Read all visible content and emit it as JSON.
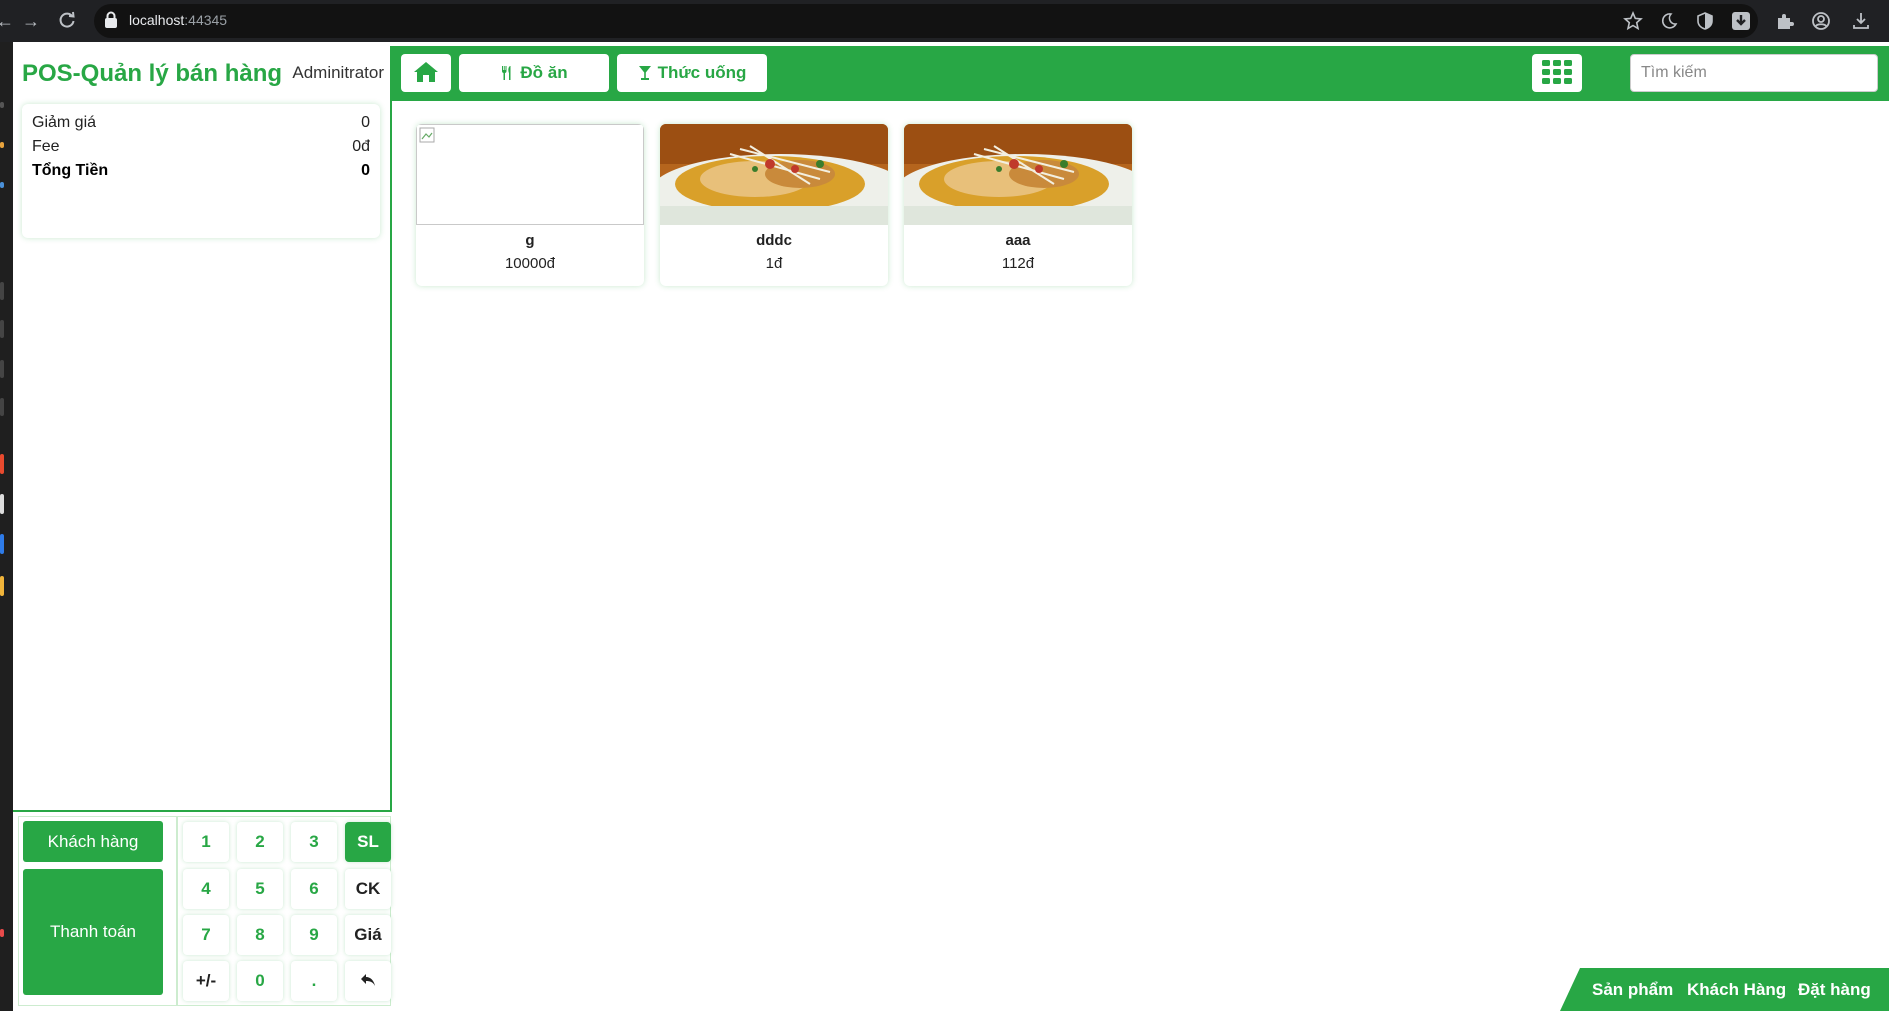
{
  "browser": {
    "url_host": "localhost",
    "url_port": ":44345"
  },
  "app": {
    "title": "POS-Quản lý bán hàng",
    "user": "Adminitrator"
  },
  "summary": {
    "discount_label": "Giảm giá",
    "discount_value": "0",
    "fee_label": "Fee",
    "fee_value": "0đ",
    "total_label": "Tổng Tiền",
    "total_value": "0"
  },
  "keypad": {
    "customer_label": "Khách hàng",
    "pay_label": "Thanh toán",
    "keys": [
      "1",
      "2",
      "3",
      "SL",
      "4",
      "5",
      "6",
      "CK",
      "7",
      "8",
      "9",
      "Giá",
      "+/-",
      "0",
      ".",
      "↶"
    ]
  },
  "toolbar": {
    "food_label": "Đồ ăn",
    "drinks_label": "Thức uống",
    "search_placeholder": "Tìm kiếm"
  },
  "products": [
    {
      "name": "g",
      "price": "10000đ",
      "has_image": false
    },
    {
      "name": "dddc",
      "price": "1đ",
      "has_image": true
    },
    {
      "name": "aaa",
      "price": "112đ",
      "has_image": true
    }
  ],
  "bottom_nav": {
    "products": "Sản phẩm",
    "customers": "Khách Hàng",
    "orders": "Đặt hàng"
  },
  "colors": {
    "accent": "#28a745",
    "chrome": "#202124"
  }
}
